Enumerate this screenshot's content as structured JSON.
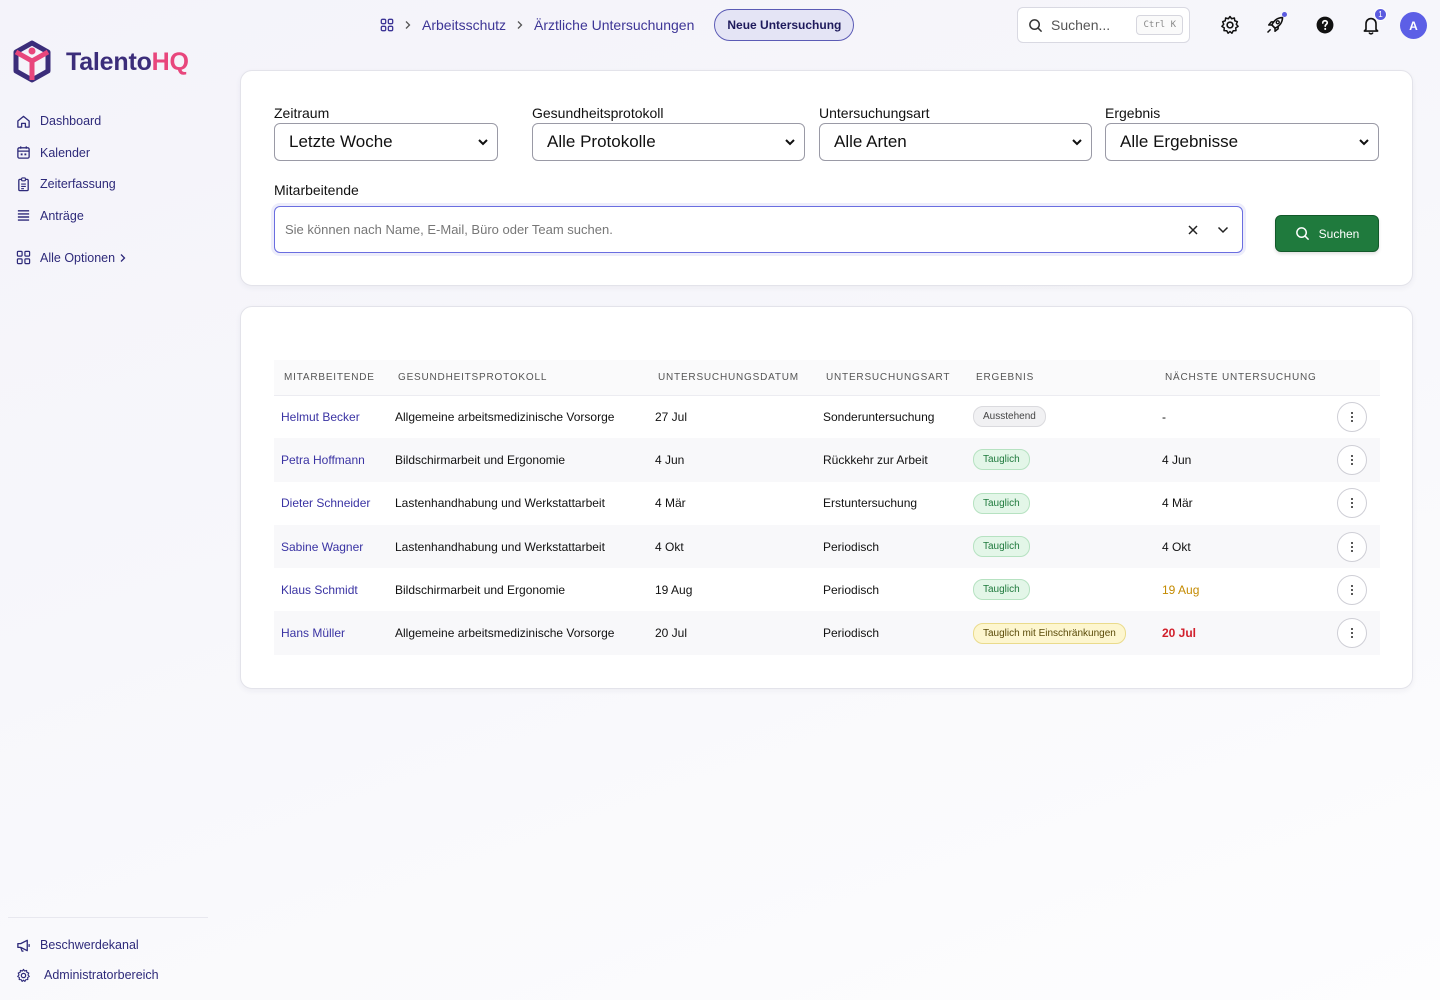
{
  "brand": {
    "part1": "Talento",
    "part2": "HQ",
    "color_primary": "#3b2d7a",
    "color_accent": "#e8467c"
  },
  "sidebar": {
    "items": [
      {
        "label": "Dashboard",
        "icon": "home-icon"
      },
      {
        "label": "Kalender",
        "icon": "calendar-icon"
      },
      {
        "label": "Zeiterfassung",
        "icon": "clipboard-icon"
      },
      {
        "label": "Anträge",
        "icon": "list-icon"
      }
    ],
    "more_label": "Alle Optionen",
    "bottom": [
      {
        "label": "Beschwerdekanal",
        "icon": "megaphone-icon"
      },
      {
        "label": "Administratorbereich",
        "icon": "gear-icon"
      }
    ]
  },
  "header": {
    "breadcrumb": [
      "Arbeitsschutz",
      "Ärztliche Untersuchungen"
    ],
    "new_button": "Neue Untersuchung",
    "search_placeholder": "Suchen...",
    "search_shortcut": "Ctrl K",
    "notification_count": "1",
    "avatar_initial": "A"
  },
  "filters": {
    "period": {
      "label": "Zeitraum",
      "value": "Letzte Woche"
    },
    "protocol": {
      "label": "Gesundheitsprotokoll",
      "value": "Alle Protokolle"
    },
    "type": {
      "label": "Untersuchungsart",
      "value": "Alle Arten"
    },
    "result": {
      "label": "Ergebnis",
      "value": "Alle Ergebnisse"
    },
    "employees": {
      "label": "Mitarbeitende",
      "placeholder": "Sie können nach Name, E-Mail, Büro oder Team suchen."
    },
    "search_button": "Suchen"
  },
  "table": {
    "columns": [
      "MITARBEITENDE",
      "GESUNDHEITSPROTOKOLL",
      "UNTERSUCHUNGSDATUM",
      "UNTERSUCHUNGSART",
      "ERGEBNIS",
      "NÄCHSTE UNTERSUCHUNG"
    ],
    "rows": [
      {
        "name": "Helmut Becker",
        "protocol": "Allgemeine arbeitsmedizinische Vorsorge",
        "date": "27 Jul",
        "type": "Sonderuntersuchung",
        "result": "Ausstehend",
        "result_style": "grey",
        "next": "-",
        "next_style": ""
      },
      {
        "name": "Petra Hoffmann",
        "protocol": "Bildschirmarbeit und Ergonomie",
        "date": "4 Jun",
        "type": "Rückkehr zur Arbeit",
        "result": "Tauglich",
        "result_style": "green",
        "next": "4 Jun",
        "next_style": ""
      },
      {
        "name": "Dieter Schneider",
        "protocol": "Lastenhandhabung und Werkstattarbeit",
        "date": "4 Mär",
        "type": "Erstuntersuchung",
        "result": "Tauglich",
        "result_style": "green",
        "next": "4 Mär",
        "next_style": ""
      },
      {
        "name": "Sabine Wagner",
        "protocol": "Lastenhandhabung und Werkstattarbeit",
        "date": "4 Okt",
        "type": "Periodisch",
        "result": "Tauglich",
        "result_style": "green",
        "next": "4 Okt",
        "next_style": ""
      },
      {
        "name": "Klaus Schmidt",
        "protocol": "Bildschirmarbeit und Ergonomie",
        "date": "19 Aug",
        "type": "Periodisch",
        "result": "Tauglich",
        "result_style": "green",
        "next": "19 Aug",
        "next_style": "warn"
      },
      {
        "name": "Hans Müller",
        "protocol": "Allgemeine arbeitsmedizinische Vorsorge",
        "date": "20 Jul",
        "type": "Periodisch",
        "result": "Tauglich mit Einschränkungen",
        "result_style": "yellow",
        "next": "20 Jul",
        "next_style": "danger"
      }
    ]
  }
}
